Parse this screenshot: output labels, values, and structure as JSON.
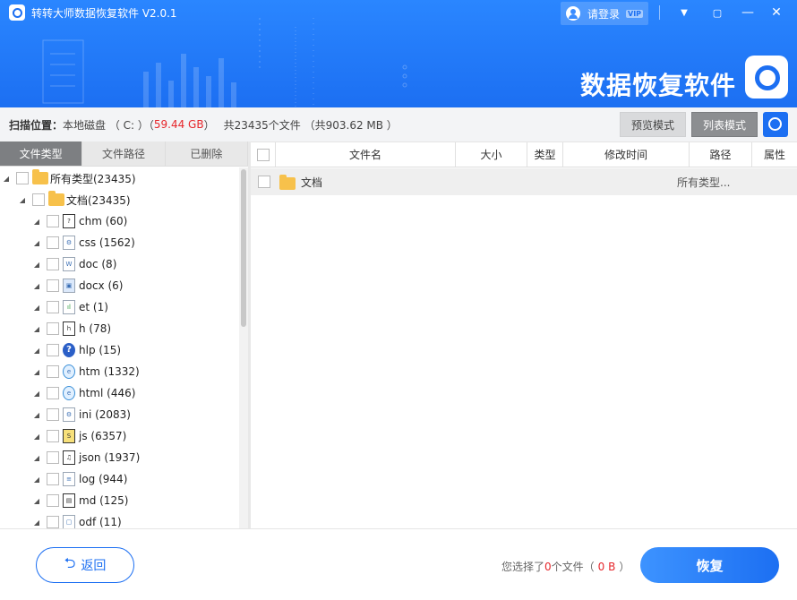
{
  "app": {
    "title": "转转大师数据恢复软件 V2.0.1",
    "login_label": "请登录",
    "vip_badge": "VIP",
    "brand_text": "数据恢复软件"
  },
  "window_controls": {
    "dropdown": "▼",
    "restore": "▢",
    "minimize": "—",
    "maximize": "☐",
    "close": "✕"
  },
  "location": {
    "label": "扫描位置：",
    "disk": "本地磁盘 （ C: ）（",
    "size": "59.44 GB",
    "size_close": " ）",
    "summary": "共23435个文件 （共903.62 MB ）"
  },
  "modes": {
    "preview": "预览模式",
    "list": "列表模式",
    "active": "list"
  },
  "tabs": [
    {
      "label": "文件类型",
      "active": true
    },
    {
      "label": "文件路径",
      "active": false
    },
    {
      "label": "已删除",
      "active": false
    }
  ],
  "tree": {
    "root": "所有类型(23435)",
    "docs": "文档(23435)",
    "items": [
      {
        "label": "chm (60)",
        "icon": "chm-icon"
      },
      {
        "label": "css (1562)",
        "icon": "css-icon"
      },
      {
        "label": "doc (8)",
        "icon": "doc-icon"
      },
      {
        "label": "docx (6)",
        "icon": "docx-icon"
      },
      {
        "label": "et (1)",
        "icon": "et-icon"
      },
      {
        "label": "h (78)",
        "icon": "h-icon"
      },
      {
        "label": "hlp (15)",
        "icon": "hlp-icon"
      },
      {
        "label": "htm (1332)",
        "icon": "htm-icon"
      },
      {
        "label": "html (446)",
        "icon": "html-icon"
      },
      {
        "label": "ini (2083)",
        "icon": "ini-icon"
      },
      {
        "label": "js (6357)",
        "icon": "js-icon"
      },
      {
        "label": "json (1937)",
        "icon": "json-icon"
      },
      {
        "label": "log (944)",
        "icon": "log-icon"
      },
      {
        "label": "md (125)",
        "icon": "md-icon"
      },
      {
        "label": "odf (11)",
        "icon": "odf-icon"
      }
    ]
  },
  "table": {
    "headers": {
      "name": "文件名",
      "size": "大小",
      "type": "类型",
      "mtime": "修改时间",
      "path": "路径",
      "attr": "属性"
    },
    "rows": [
      {
        "name": "文档",
        "path": "所有类型..."
      }
    ]
  },
  "footer": {
    "back_label": "返回",
    "sel_prefix": "您选择了",
    "sel_count": "0",
    "sel_mid": "个文件（",
    "sel_size": "0 B",
    "sel_suffix": "）",
    "recover_label": "恢复"
  },
  "colors": {
    "primary": "#1c6ff2",
    "accent_red": "#e6262b",
    "active_tab": "#7d7f82"
  }
}
